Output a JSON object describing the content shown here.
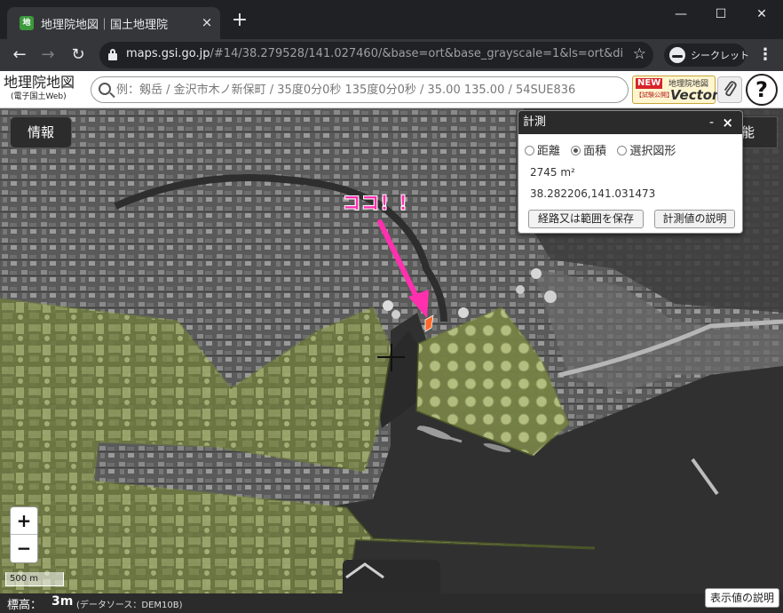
{
  "browser": {
    "tab_title": "地理院地図｜国土地理院",
    "tab_close": "×",
    "new_tab": "+",
    "url_host": "maps.gsi.go.jp",
    "url_rest": "/#14/38.279528/141.027460/&base=ort&base_grayscale=1&ls=ort&disp...",
    "incognito_label": "シークレット",
    "minimize": "—",
    "maximize": "☐",
    "close": "✕",
    "back": "←",
    "forward": "→",
    "reload": "↻",
    "star": "☆",
    "menu": "⋮"
  },
  "header": {
    "logo_main": "地理院地図",
    "logo_sub": "(電子国土Web)",
    "search_placeholder": "例：剱岳 / 金沢市木ノ新保町 / 35度0分0秒 135度0分0秒 / 35.00 135.00 / 54SUE836",
    "vector_new": "NEW",
    "vector_trial": "【試験公開】",
    "vector_name": "地理院地図",
    "vector_word": "Vector",
    "clip_icon": "🔗",
    "help": "?"
  },
  "map": {
    "info_button": "情報",
    "function_button": "能",
    "annotation": "ココ！！",
    "annotation_color": "#ff2fae",
    "polygon_color": "#8fb21a"
  },
  "measure": {
    "title": "計測",
    "minimize": "-",
    "close": "×",
    "options": [
      "距離",
      "面積",
      "選択図形"
    ],
    "selected_option": "面積",
    "area": "2745 m²",
    "coordinate": "38.282206,141.031473",
    "save_button": "経路又は範囲を保存",
    "explain_button": "計測値の説明"
  },
  "controls": {
    "zoom_in": "+",
    "zoom_out": "−",
    "scale": "500 m"
  },
  "status": {
    "elevation_label": "標高：",
    "elevation_value": "3m",
    "elevation_source": "(データソース：DEM10B)",
    "explain_button": "表示値の説明"
  }
}
